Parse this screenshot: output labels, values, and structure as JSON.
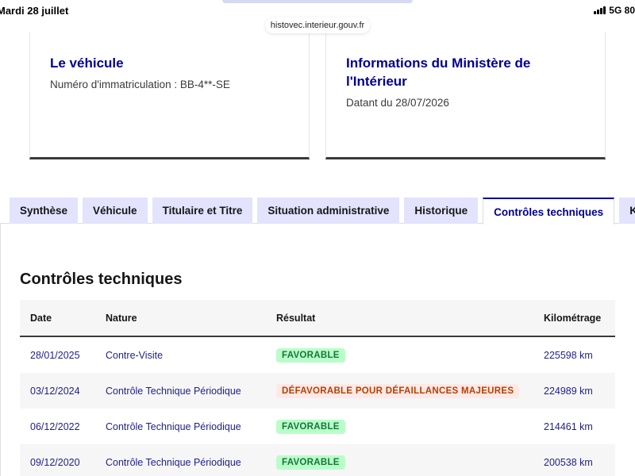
{
  "status_bar": {
    "date": "Mardi 28 juillet",
    "network": "5G 80"
  },
  "browser": {
    "url": "histovec.interieur.gouv.fr"
  },
  "cards": {
    "vehicle": {
      "title": "Le véhicule",
      "text": "Numéro d'immatriculation : BB-4**-SE"
    },
    "ministry": {
      "title": "Informations du Ministère de l'Intérieur",
      "text": "Datant du 28/07/2026"
    }
  },
  "tabs": [
    {
      "label": "Synthèse",
      "active": false
    },
    {
      "label": "Véhicule",
      "active": false
    },
    {
      "label": "Titulaire et Titre",
      "active": false
    },
    {
      "label": "Situation administrative",
      "active": false
    },
    {
      "label": "Historique",
      "active": false
    },
    {
      "label": "Contrôles techniques",
      "active": true
    },
    {
      "label": "Kilo",
      "active": false
    }
  ],
  "section": {
    "title": "Contrôles techniques"
  },
  "table": {
    "headers": {
      "date": "Date",
      "nature": "Nature",
      "result": "Résultat",
      "km": "Kilométrage"
    },
    "rows": [
      {
        "date": "28/01/2025",
        "nature": "Contre-Visite",
        "result": "FAVORABLE",
        "status": "ok",
        "km": "225598 km"
      },
      {
        "date": "03/12/2024",
        "nature": "Contrôle Technique Périodique",
        "result": "DÉFAVORABLE POUR DÉFAILLANCES MAJEURES",
        "status": "ko",
        "km": "224989 km"
      },
      {
        "date": "06/12/2022",
        "nature": "Contrôle Technique Périodique",
        "result": "FAVORABLE",
        "status": "ok",
        "km": "214461 km"
      },
      {
        "date": "09/12/2020",
        "nature": "Contrôle Technique Périodique",
        "result": "FAVORABLE",
        "status": "ok",
        "km": "200538 km"
      }
    ]
  },
  "colors": {
    "primary": "#000091",
    "tab_bg": "#e3e3fd",
    "badge_ok_bg": "#b8fec9",
    "badge_ok_text": "#18753c",
    "badge_ko_bg": "#ffe9e6",
    "badge_ko_text": "#b34000"
  }
}
